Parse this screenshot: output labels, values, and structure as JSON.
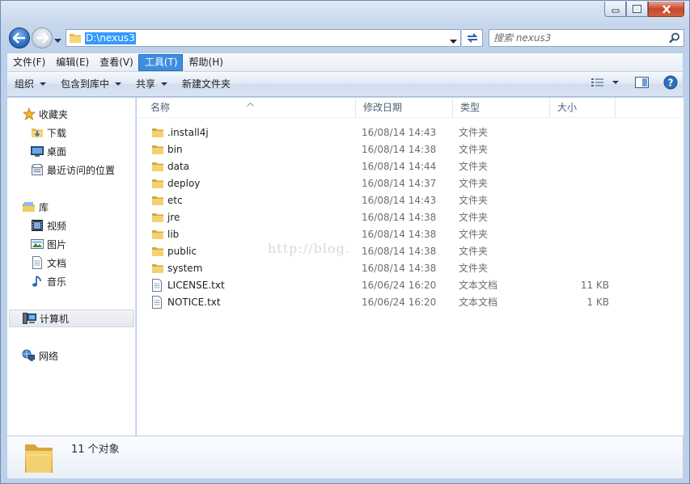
{
  "address": {
    "path": "D:\\nexus3"
  },
  "search": {
    "placeholder": "搜索 nexus3"
  },
  "menu": [
    "文件(F)",
    "编辑(E)",
    "查看(V)",
    "工具(T)",
    "帮助(H)"
  ],
  "menu_active_index": 3,
  "commands": {
    "organize": "组织",
    "include": "包含到库中",
    "share": "共享",
    "new_folder": "新建文件夹"
  },
  "nav": {
    "favorites": "收藏夹",
    "downloads": "下载",
    "desktop": "桌面",
    "recent": "最近访问的位置",
    "libraries": "库",
    "videos": "视频",
    "pictures": "图片",
    "documents": "文档",
    "music": "音乐",
    "computer": "计算机",
    "network": "网络"
  },
  "columns": {
    "name": "名称",
    "date": "修改日期",
    "type": "类型",
    "size": "大小"
  },
  "files": [
    {
      "name": ".install4j",
      "date": "16/08/14 14:43",
      "type": "文件夹",
      "size": "",
      "kind": "folder"
    },
    {
      "name": "bin",
      "date": "16/08/14 14:38",
      "type": "文件夹",
      "size": "",
      "kind": "folder"
    },
    {
      "name": "data",
      "date": "16/08/14 14:44",
      "type": "文件夹",
      "size": "",
      "kind": "folder"
    },
    {
      "name": "deploy",
      "date": "16/08/14 14:37",
      "type": "文件夹",
      "size": "",
      "kind": "folder"
    },
    {
      "name": "etc",
      "date": "16/08/14 14:43",
      "type": "文件夹",
      "size": "",
      "kind": "folder"
    },
    {
      "name": "jre",
      "date": "16/08/14 14:38",
      "type": "文件夹",
      "size": "",
      "kind": "folder"
    },
    {
      "name": "lib",
      "date": "16/08/14 14:38",
      "type": "文件夹",
      "size": "",
      "kind": "folder"
    },
    {
      "name": "public",
      "date": "16/08/14 14:38",
      "type": "文件夹",
      "size": "",
      "kind": "folder"
    },
    {
      "name": "system",
      "date": "16/08/14 14:38",
      "type": "文件夹",
      "size": "",
      "kind": "folder"
    },
    {
      "name": "LICENSE.txt",
      "date": "16/06/24 16:20",
      "type": "文本文档",
      "size": "11 KB",
      "kind": "text"
    },
    {
      "name": "NOTICE.txt",
      "date": "16/06/24 16:20",
      "type": "文本文档",
      "size": "1 KB",
      "kind": "text"
    }
  ],
  "watermark": "http://blog.",
  "status": {
    "count": "11 个对象"
  },
  "colors": {
    "selection": "#3399ff",
    "menu_active": "#3d8ee0",
    "folder": "#f2c85b",
    "frame": "#bcd0ea"
  }
}
